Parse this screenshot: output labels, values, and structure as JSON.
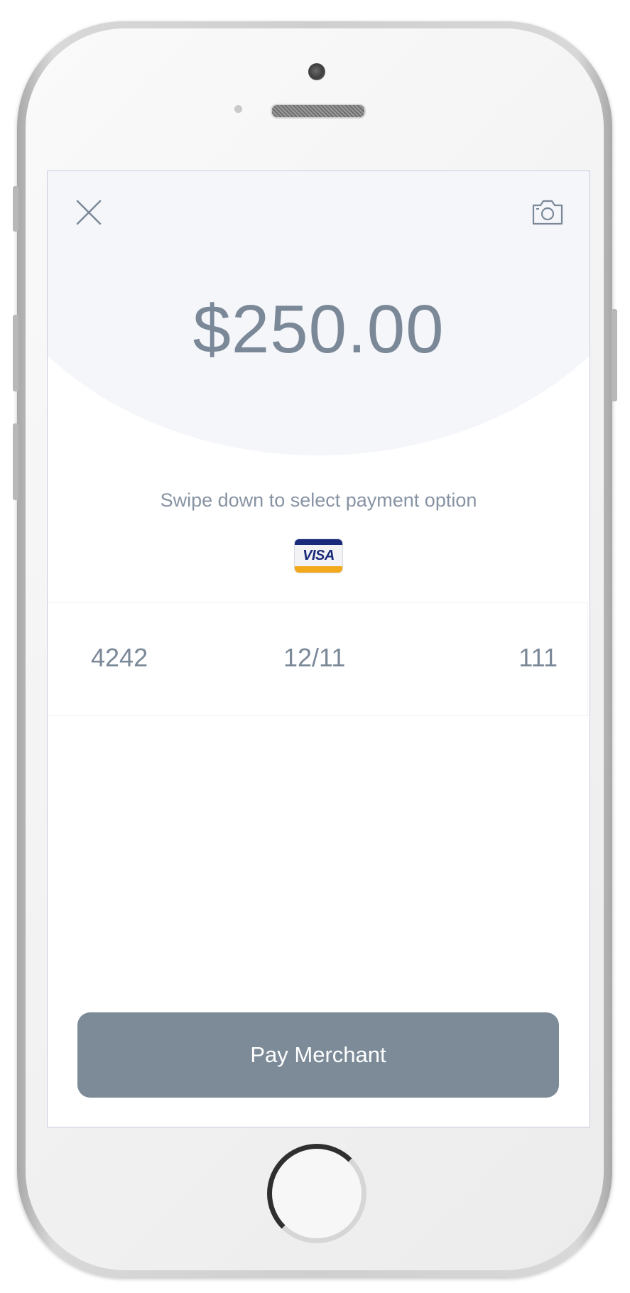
{
  "payment": {
    "amount": "$250.00",
    "hint": "Swipe down to select payment option",
    "card_brand": "VISA",
    "card": {
      "number_last4": "4242",
      "expiry": "12/11",
      "cvc": "111"
    },
    "pay_label": "Pay Merchant"
  },
  "icons": {
    "close": "close-icon",
    "camera": "camera-icon",
    "card_brand": "visa-card-icon"
  },
  "colors": {
    "text_primary": "#7b8898",
    "hero_background": "#f5f6fa",
    "pay_button": "#7d8b99",
    "visa_blue": "#1a2a7a",
    "visa_gold": "#f2a91b"
  }
}
